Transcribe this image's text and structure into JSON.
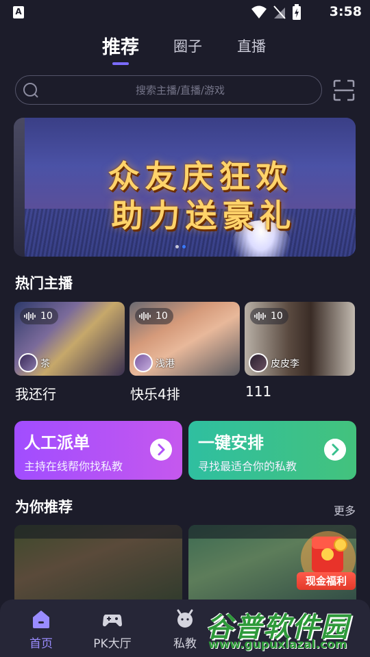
{
  "status_bar": {
    "app_icon": "A",
    "time": "3:58"
  },
  "top_tabs": [
    "推荐",
    "圈子",
    "直播"
  ],
  "search": {
    "placeholder": "搜索主播/直播/游戏"
  },
  "banner": {
    "line1": "众友庆狂欢",
    "line2": "助力送豪礼"
  },
  "hot_hosts": {
    "title": "热门主播",
    "cards": [
      {
        "count": "10",
        "host": "茶",
        "title": "我还行"
      },
      {
        "count": "10",
        "host": "浅港",
        "title": "快乐4排"
      },
      {
        "count": "10",
        "host": "皮皮李",
        "title": "111"
      }
    ]
  },
  "actions": [
    {
      "title": "人工派单",
      "subtitle": "主持在线帮你找私教"
    },
    {
      "title": "一键安排",
      "subtitle": "寻找最适合你的私教"
    }
  ],
  "recommend": {
    "title": "为你推荐",
    "more": "更多",
    "promo": "现金福利"
  },
  "bottom_nav": [
    "首页",
    "PK大厅",
    "私教"
  ],
  "watermark": {
    "text": "谷普软件园",
    "url": "www.gupuxlazal.com"
  },
  "colors": {
    "accent": "#7b6cff",
    "background": "#1c1c2a",
    "action_left": "#b052f8",
    "action_right": "#38c08e"
  }
}
